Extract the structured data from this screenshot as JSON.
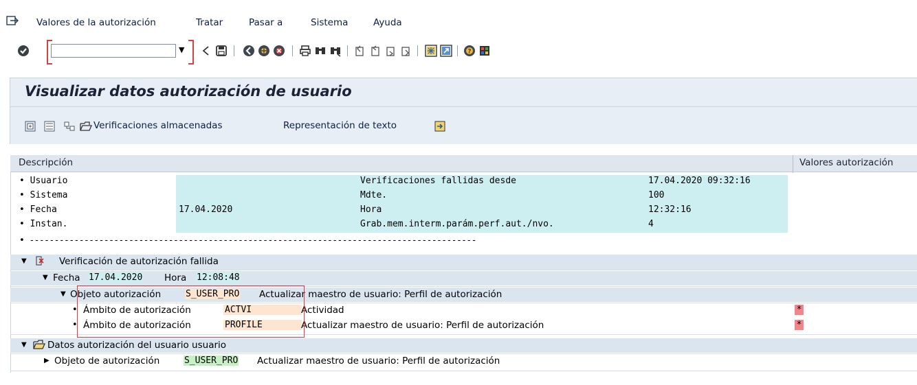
{
  "menubar": {
    "items": [
      "Valores de la autorización",
      "Tratar",
      "Pasar a",
      "Sistema",
      "Ayuda"
    ]
  },
  "toolbar": {
    "command_field_value": "",
    "icons": [
      "enter-icon",
      "back-icon",
      "save-icon",
      "nav-back-icon",
      "exit-icon",
      "cancel-icon",
      "print-icon",
      "find-icon",
      "find-next-icon",
      "first-page-icon",
      "prev-page-icon",
      "next-page-icon",
      "last-page-icon",
      "new-session-icon",
      "shortcut-icon",
      "help-icon",
      "customize-icon"
    ]
  },
  "title": "Visualizar datos autorización de usuario",
  "app_toolbar": {
    "expand_icon": "expand-all-icon",
    "collapse_icon": "collapse-all-icon",
    "hierarchy_icon": "hierarchy-icon",
    "stored_checks_label": "Verificaciones almacenadas",
    "text_repr_label": "Representación de texto",
    "export_icon": "export-icon"
  },
  "tree": {
    "headers": {
      "description": "Descripción",
      "values": "Valores autorización"
    },
    "info": [
      {
        "label": "• Usuario",
        "value": "",
        "label2": "Verificaciones fallidas desde",
        "value2": "17.04.2020 09:32:16"
      },
      {
        "label": "• Sistema",
        "value": "",
        "label2": "Mdte.",
        "value2": "100"
      },
      {
        "label": "• Fecha",
        "value": "17.04.2020",
        "label2": "Hora",
        "value2": "12:32:16"
      },
      {
        "label": "• Instan.",
        "value": "",
        "label2": "Grab.mem.interm.parám.perf.aut./nvo.",
        "value2": "4"
      }
    ],
    "dashes": "• ------------------------------------------------------------------------------------------",
    "failed_node": "Verificación de autorización fallida",
    "date_node": {
      "fecha_label": "Fecha",
      "fecha": "17.04.2020",
      "hora_label": "Hora",
      "hora": "12:08:48"
    },
    "object_node": {
      "label": "Objeto autorización",
      "object": "S_USER_PRO",
      "desc": "Actualizar maestro de usuario: Perfil de autorización"
    },
    "fields": [
      {
        "label": "Ámbito de autorización",
        "field": "ACTVI",
        "desc": "Actividad",
        "value": "*"
      },
      {
        "label": "Ámbito de autorización",
        "field": "PROFILE",
        "desc": "Actualizar maestro de usuario: Perfil de autorización",
        "value": "*"
      }
    ],
    "user_data_node": "Datos autorización del usuario usuario",
    "user_object": {
      "label": "Objeto de autorización",
      "object": "S_USER_PRO",
      "desc": "Actualizar maestro de usuario: Perfil de autorización"
    }
  },
  "colors": {
    "cyan": "#cdeff2",
    "salmon": "#fde5cf",
    "green": "#c7f0c4",
    "red": "#f0858a",
    "highlight_box": "#e2383b"
  }
}
